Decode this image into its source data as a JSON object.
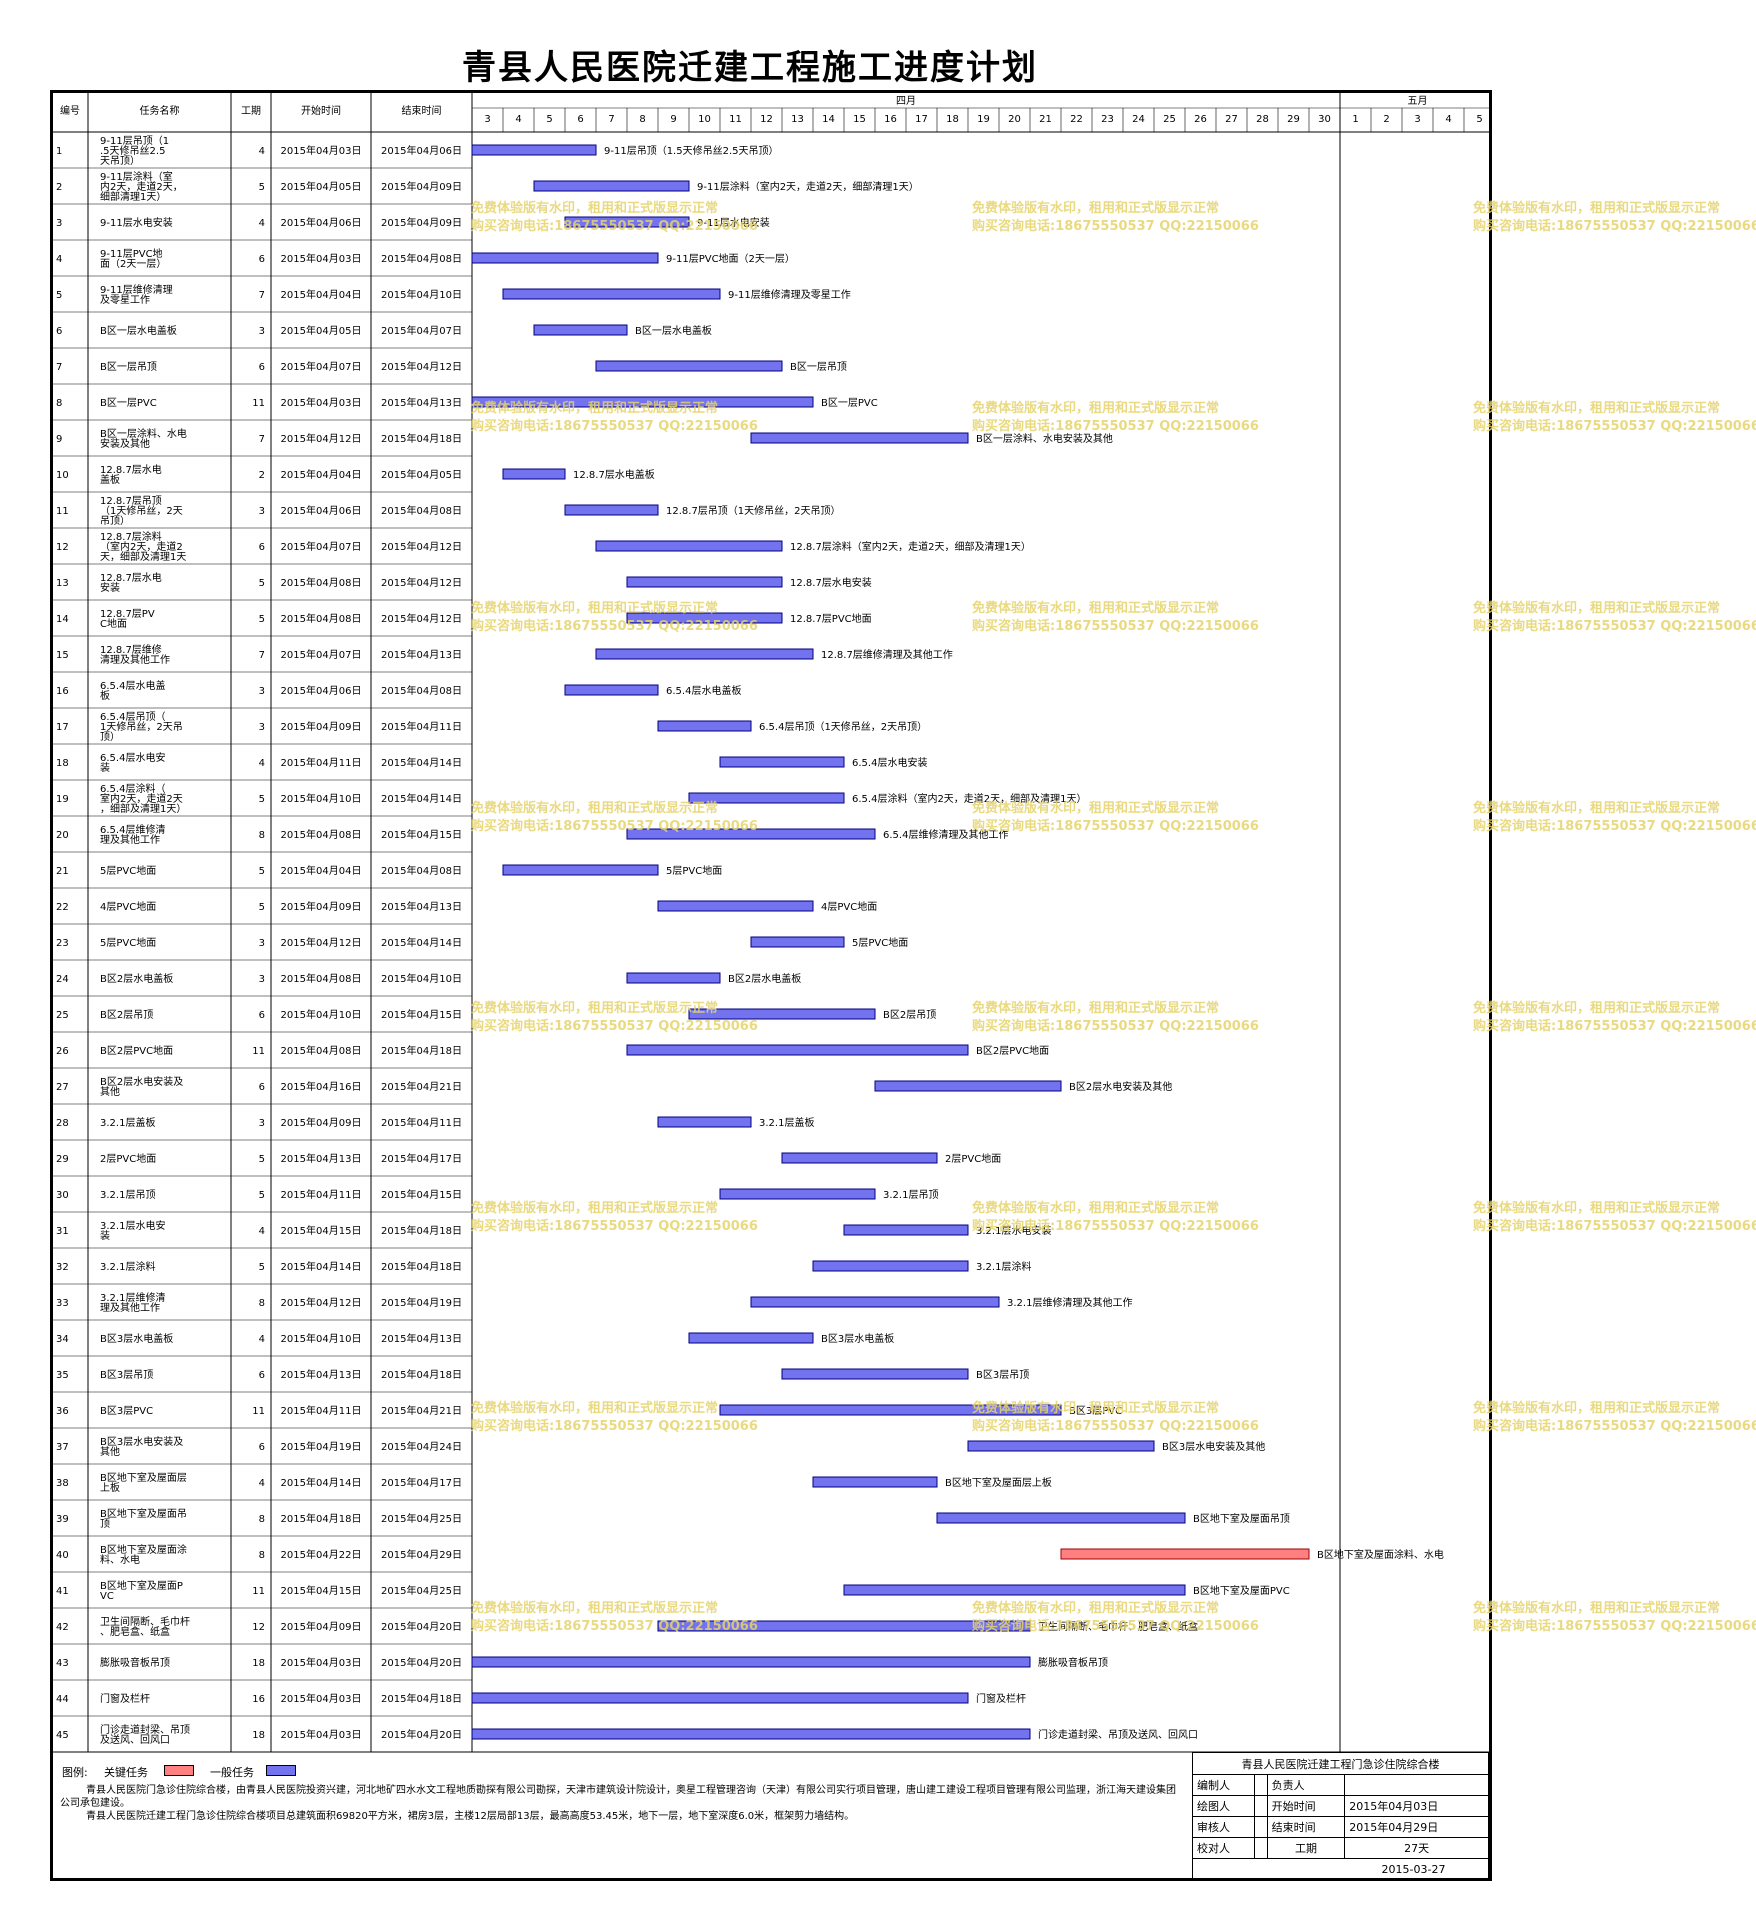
{
  "title": "青县人民医院迁建工程施工进度计划",
  "columns": [
    "编号",
    "任务名称",
    "工期",
    "开始时间",
    "结束时间"
  ],
  "months": [
    {
      "label": "四月",
      "days": [
        3,
        4,
        5,
        6,
        7,
        8,
        9,
        10,
        11,
        12,
        13,
        14,
        15,
        16,
        17,
        18,
        19,
        20,
        21,
        22,
        23,
        24,
        25,
        26,
        27,
        28,
        29,
        30
      ]
    },
    {
      "label": "五月",
      "days": [
        1,
        2,
        3,
        4,
        5
      ]
    }
  ],
  "colors": {
    "normal": "#7373f0",
    "critical": "#ff8080",
    "bar_border": "#000080",
    "watermark": "#e6d36a"
  },
  "tasks": [
    {
      "id": "1",
      "name": "9-11层吊顶（1.5天修吊丝2.5天吊顶）",
      "dur": "4",
      "start": "2015年04月03日",
      "end": "2015年04月06日",
      "label": "9-11层吊顶（1.5天修吊丝2.5天吊顶）",
      "s": 3,
      "e": 6,
      "critical": false
    },
    {
      "id": "2",
      "name": "9-11层涂料（室内2天，走道2天，细部清理1天）",
      "dur": "5",
      "start": "2015年04月05日",
      "end": "2015年04月09日",
      "label": "9-11层涂料（室内2天，走道2天，细部清理1天）",
      "s": 5,
      "e": 9,
      "critical": false
    },
    {
      "id": "3",
      "name": "9-11层水电安装",
      "dur": "4",
      "start": "2015年04月06日",
      "end": "2015年04月09日",
      "label": "9-11层水电安装",
      "s": 6,
      "e": 9,
      "critical": false
    },
    {
      "id": "4",
      "name": "9-11层PVC地面（2天一层）",
      "dur": "6",
      "start": "2015年04月03日",
      "end": "2015年04月08日",
      "label": "9-11层PVC地面（2天一层）",
      "s": 3,
      "e": 8,
      "critical": false
    },
    {
      "id": "5",
      "name": "9-11层维修清理及零星工作",
      "dur": "7",
      "start": "2015年04月04日",
      "end": "2015年04月10日",
      "label": "9-11层维修清理及零星工作",
      "s": 4,
      "e": 10,
      "critical": false
    },
    {
      "id": "6",
      "name": "B区一层水电盖板",
      "dur": "3",
      "start": "2015年04月05日",
      "end": "2015年04月07日",
      "label": "B区一层水电盖板",
      "s": 5,
      "e": 7,
      "critical": false
    },
    {
      "id": "7",
      "name": "B区一层吊顶",
      "dur": "6",
      "start": "2015年04月07日",
      "end": "2015年04月12日",
      "label": "B区一层吊顶",
      "s": 7,
      "e": 12,
      "critical": false
    },
    {
      "id": "8",
      "name": "B区一层PVC",
      "dur": "11",
      "start": "2015年04月03日",
      "end": "2015年04月13日",
      "label": "B区一层PVC",
      "s": 3,
      "e": 13,
      "critical": false
    },
    {
      "id": "9",
      "name": "B区一层涂料、水电安装及其他",
      "dur": "7",
      "start": "2015年04月12日",
      "end": "2015年04月18日",
      "label": "B区一层涂料、水电安装及其他",
      "s": 12,
      "e": 18,
      "critical": false
    },
    {
      "id": "10",
      "name": "12.8.7层水电盖板",
      "dur": "2",
      "start": "2015年04月04日",
      "end": "2015年04月05日",
      "label": "12.8.7层水电盖板",
      "s": 4,
      "e": 5,
      "critical": false
    },
    {
      "id": "11",
      "name": "12.8.7层吊顶（1天修吊丝，2天吊顶）",
      "dur": "3",
      "start": "2015年04月06日",
      "end": "2015年04月08日",
      "label": "12.8.7层吊顶（1天修吊丝，2天吊顶）",
      "s": 6,
      "e": 8,
      "critical": false
    },
    {
      "id": "12",
      "name": "12.8.7层涂料（室内2天，走道2天，细部及清理1天）",
      "dur": "6",
      "start": "2015年04月07日",
      "end": "2015年04月12日",
      "label": "12.8.7层涂料（室内2天，走道2天，细部及清理1天）",
      "s": 7,
      "e": 12,
      "critical": false
    },
    {
      "id": "13",
      "name": "12.8.7层水电安装",
      "dur": "5",
      "start": "2015年04月08日",
      "end": "2015年04月12日",
      "label": "12.8.7层水电安装",
      "s": 8,
      "e": 12,
      "critical": false
    },
    {
      "id": "14",
      "name": "12.8.7层PVC地面",
      "dur": "5",
      "start": "2015年04月08日",
      "end": "2015年04月12日",
      "label": "12.8.7层PVC地面",
      "s": 8,
      "e": 12,
      "critical": false
    },
    {
      "id": "15",
      "name": "12.8.7层维修清理及其他工作",
      "dur": "7",
      "start": "2015年04月07日",
      "end": "2015年04月13日",
      "label": "12.8.7层维修清理及其他工作",
      "s": 7,
      "e": 13,
      "critical": false
    },
    {
      "id": "16",
      "name": "6.5.4层水电盖板",
      "dur": "3",
      "start": "2015年04月06日",
      "end": "2015年04月08日",
      "label": "6.5.4层水电盖板",
      "s": 6,
      "e": 8,
      "critical": false
    },
    {
      "id": "17",
      "name": "6.5.4层吊顶（1天修吊丝，2天吊顶）",
      "dur": "3",
      "start": "2015年04月09日",
      "end": "2015年04月11日",
      "label": "6.5.4层吊顶（1天修吊丝，2天吊顶）",
      "s": 9,
      "e": 11,
      "critical": false
    },
    {
      "id": "18",
      "name": "6.5.4层水电安装",
      "dur": "4",
      "start": "2015年04月11日",
      "end": "2015年04月14日",
      "label": "6.5.4层水电安装",
      "s": 11,
      "e": 14,
      "critical": false
    },
    {
      "id": "19",
      "name": "6.5.4层涂料（室内2天，走道2天，细部及清理1天）",
      "dur": "5",
      "start": "2015年04月10日",
      "end": "2015年04月14日",
      "label": "6.5.4层涂料（室内2天，走道2天，细部及清理1天）",
      "s": 10,
      "e": 14,
      "critical": false
    },
    {
      "id": "20",
      "name": "6.5.4层维修清理及其他工作",
      "dur": "8",
      "start": "2015年04月08日",
      "end": "2015年04月15日",
      "label": "6.5.4层维修清理及其他工作",
      "s": 8,
      "e": 15,
      "critical": false
    },
    {
      "id": "21",
      "name": "5层PVC地面",
      "dur": "5",
      "start": "2015年04月04日",
      "end": "2015年04月08日",
      "label": "5层PVC地面",
      "s": 4,
      "e": 8,
      "critical": false
    },
    {
      "id": "22",
      "name": "4层PVC地面",
      "dur": "5",
      "start": "2015年04月09日",
      "end": "2015年04月13日",
      "label": "4层PVC地面",
      "s": 9,
      "e": 13,
      "critical": false
    },
    {
      "id": "23",
      "name": "5层PVC地面",
      "dur": "3",
      "start": "2015年04月12日",
      "end": "2015年04月14日",
      "label": "5层PVC地面",
      "s": 12,
      "e": 14,
      "critical": false
    },
    {
      "id": "24",
      "name": "B区2层水电盖板",
      "dur": "3",
      "start": "2015年04月08日",
      "end": "2015年04月10日",
      "label": "B区2层水电盖板",
      "s": 8,
      "e": 10,
      "critical": false
    },
    {
      "id": "25",
      "name": "B区2层吊顶",
      "dur": "6",
      "start": "2015年04月10日",
      "end": "2015年04月15日",
      "label": "B区2层吊顶",
      "s": 10,
      "e": 15,
      "critical": false
    },
    {
      "id": "26",
      "name": "B区2层PVC地面",
      "dur": "11",
      "start": "2015年04月08日",
      "end": "2015年04月18日",
      "label": "B区2层PVC地面",
      "s": 8,
      "e": 18,
      "critical": false
    },
    {
      "id": "27",
      "name": "B区2层水电安装及其他",
      "dur": "6",
      "start": "2015年04月16日",
      "end": "2015年04月21日",
      "label": "B区2层水电安装及其他",
      "s": 16,
      "e": 21,
      "critical": false
    },
    {
      "id": "28",
      "name": "3.2.1层盖板",
      "dur": "3",
      "start": "2015年04月09日",
      "end": "2015年04月11日",
      "label": "3.2.1层盖板",
      "s": 9,
      "e": 11,
      "critical": false
    },
    {
      "id": "29",
      "name": "2层PVC地面",
      "dur": "5",
      "start": "2015年04月13日",
      "end": "2015年04月17日",
      "label": "2层PVC地面",
      "s": 13,
      "e": 17,
      "critical": false
    },
    {
      "id": "30",
      "name": "3.2.1层吊顶",
      "dur": "5",
      "start": "2015年04月11日",
      "end": "2015年04月15日",
      "label": "3.2.1层吊顶",
      "s": 11,
      "e": 15,
      "critical": false
    },
    {
      "id": "31",
      "name": "3.2.1层水电安装",
      "dur": "4",
      "start": "2015年04月15日",
      "end": "2015年04月18日",
      "label": "3.2.1层水电安装",
      "s": 15,
      "e": 18,
      "critical": false
    },
    {
      "id": "32",
      "name": "3.2.1层涂料",
      "dur": "5",
      "start": "2015年04月14日",
      "end": "2015年04月18日",
      "label": "3.2.1层涂料",
      "s": 14,
      "e": 18,
      "critical": false
    },
    {
      "id": "33",
      "name": "3.2.1层维修清理及其他工作",
      "dur": "8",
      "start": "2015年04月12日",
      "end": "2015年04月19日",
      "label": "3.2.1层维修清理及其他工作",
      "s": 12,
      "e": 19,
      "critical": false
    },
    {
      "id": "34",
      "name": "B区3层水电盖板",
      "dur": "4",
      "start": "2015年04月10日",
      "end": "2015年04月13日",
      "label": "B区3层水电盖板",
      "s": 10,
      "e": 13,
      "critical": false
    },
    {
      "id": "35",
      "name": "B区3层吊顶",
      "dur": "6",
      "start": "2015年04月13日",
      "end": "2015年04月18日",
      "label": "B区3层吊顶",
      "s": 13,
      "e": 18,
      "critical": false
    },
    {
      "id": "36",
      "name": "B区3层PVC",
      "dur": "11",
      "start": "2015年04月11日",
      "end": "2015年04月21日",
      "label": "B区3层PVC",
      "s": 11,
      "e": 21,
      "critical": false
    },
    {
      "id": "37",
      "name": "B区3层水电安装及其他",
      "dur": "6",
      "start": "2015年04月19日",
      "end": "2015年04月24日",
      "label": "B区3层水电安装及其他",
      "s": 19,
      "e": 24,
      "critical": false
    },
    {
      "id": "38",
      "name": "B区地下室及屋面层上板",
      "dur": "4",
      "start": "2015年04月14日",
      "end": "2015年04月17日",
      "label": "B区地下室及屋面层上板",
      "s": 14,
      "e": 17,
      "critical": false
    },
    {
      "id": "39",
      "name": "B区地下室及屋面吊顶",
      "dur": "8",
      "start": "2015年04月18日",
      "end": "2015年04月25日",
      "label": "B区地下室及屋面吊顶",
      "s": 18,
      "e": 25,
      "critical": false
    },
    {
      "id": "40",
      "name": "B区地下室及屋面涂料、水电",
      "dur": "8",
      "start": "2015年04月22日",
      "end": "2015年04月29日",
      "label": "B区地下室及屋面涂料、水电",
      "s": 22,
      "e": 29,
      "critical": true
    },
    {
      "id": "41",
      "name": "B区地下室及屋面PVC",
      "dur": "11",
      "start": "2015年04月15日",
      "end": "2015年04月25日",
      "label": "B区地下室及屋面PVC",
      "s": 15,
      "e": 25,
      "critical": false
    },
    {
      "id": "42",
      "name": "卫生间隔断、毛巾杆、肥皂盒、纸盒",
      "dur": "12",
      "start": "2015年04月09日",
      "end": "2015年04月20日",
      "label": "卫生间隔断、毛巾杆、肥皂盒、纸盒",
      "s": 9,
      "e": 20,
      "critical": false
    },
    {
      "id": "43",
      "name": "膨胀吸音板吊顶",
      "dur": "18",
      "start": "2015年04月03日",
      "end": "2015年04月20日",
      "label": "膨胀吸音板吊顶",
      "s": 3,
      "e": 20,
      "critical": false
    },
    {
      "id": "44",
      "name": "门窗及栏杆",
      "dur": "16",
      "start": "2015年04月03日",
      "end": "2015年04月18日",
      "label": "门窗及栏杆",
      "s": 3,
      "e": 18,
      "critical": false
    },
    {
      "id": "45",
      "name": "门诊走道封梁、吊顶及送风、回风口",
      "dur": "18",
      "start": "2015年04月03日",
      "end": "2015年04月20日",
      "label": "门诊走道封梁、吊顶及送风、回风口",
      "s": 3,
      "e": 20,
      "critical": false
    }
  ],
  "legend": {
    "title": "图例:",
    "critical": "关键任务",
    "normal": "一般任务"
  },
  "description": [
    "青县人民医院门急诊住院综合楼，由青县人民医院投资兴建，河北地矿四水水文工程地质勘探有限公司勘探，天津市建筑设计院设计，奥星工程管理咨询（天津）有限公司实行项目管理，唐山建工建设工程项目管理有限公司监理，浙江海天建设集团公司承包建设。",
    "青县人民医院迁建工程门急诊住院综合楼项目总建筑面积69820平方米，裙房3层，主楼12层局部13层，最高高度53.45米，地下一层，地下室深度6.0米，框架剪力墙结构。"
  ],
  "signoff": {
    "header": "青县人民医院迁建工程门急诊住院综合楼",
    "rows": [
      [
        "编制人",
        "",
        "负责人",
        ""
      ],
      [
        "绘图人",
        "",
        "开始时间",
        "2015年04月03日"
      ],
      [
        "审核人",
        "",
        "结束时间",
        "2015年04月29日"
      ],
      [
        "校对人",
        "",
        "工期",
        "27天"
      ]
    ],
    "date": "2015-03-27"
  },
  "watermark": {
    "line1": "免费体验版有水印，租用和正式版显示正常",
    "line2": "购买咨询电话:18675550537 QQ:22150066"
  }
}
